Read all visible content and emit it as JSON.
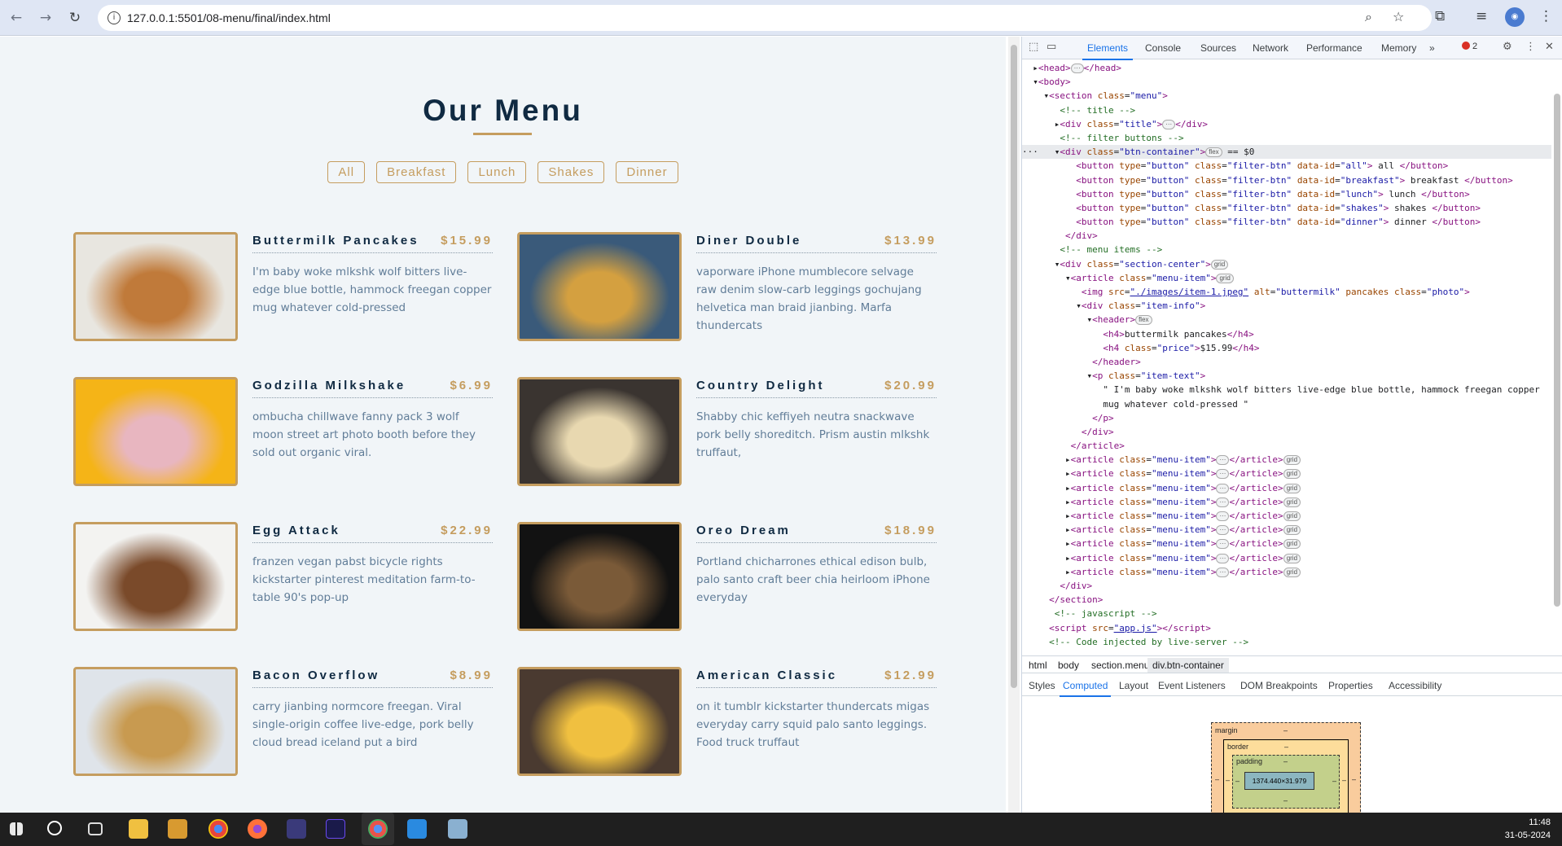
{
  "browser": {
    "url": "127.0.0.1:5501/08-menu/final/index.html"
  },
  "page": {
    "title": "Our Menu",
    "filters": [
      "All",
      "Breakfast",
      "Lunch",
      "Shakes",
      "Dinner"
    ],
    "items": [
      {
        "name": "Buttermilk Pancakes",
        "price": "$15.99",
        "text": "I'm baby woke mlkshk wolf bitters live-edge blue bottle, hammock freegan copper mug whatever cold-pressed",
        "photo_colors": [
          "#e8e6e0",
          "#c07a3a"
        ]
      },
      {
        "name": "Diner Double",
        "price": "$13.99",
        "text": "vaporware iPhone mumblecore selvage raw denim slow-carb leggings gochujang helvetica man braid jianbing. Marfa thundercats",
        "photo_colors": [
          "#3a5a7a",
          "#d4a040"
        ]
      },
      {
        "name": "Godzilla Milkshake",
        "price": "$6.99",
        "text": "ombucha chillwave fanny pack 3 wolf moon street art photo booth before they sold out organic viral.",
        "photo_colors": [
          "#f5b417",
          "#e8b6c0"
        ]
      },
      {
        "name": "Country Delight",
        "price": "$20.99",
        "text": "Shabby chic keffiyeh neutra snackwave pork belly shoreditch. Prism austin mlkshk truffaut,",
        "photo_colors": [
          "#3a3430",
          "#e8d8b0"
        ]
      },
      {
        "name": "Egg Attack",
        "price": "$22.99",
        "text": "franzen vegan pabst bicycle rights kickstarter pinterest meditation farm-to-table 90's pop-up",
        "photo_colors": [
          "#f3f3f1",
          "#7a4a2a"
        ]
      },
      {
        "name": "Oreo Dream",
        "price": "$18.99",
        "text": "Portland chicharrones ethical edison bulb, palo santo craft beer chia heirloom iPhone everyday",
        "photo_colors": [
          "#121212",
          "#7a5a38"
        ]
      },
      {
        "name": "Bacon Overflow",
        "price": "$8.99",
        "text": "carry jianbing normcore freegan. Viral single-origin coffee live-edge, pork belly cloud bread iceland put a bird",
        "photo_colors": [
          "#dfe4ea",
          "#c89a50"
        ]
      },
      {
        "name": "American Classic",
        "price": "$12.99",
        "text": "on it tumblr kickstarter thundercats migas everyday carry squid palo santo leggings. Food truck truffaut",
        "photo_colors": [
          "#4a3a30",
          "#f0c040"
        ]
      }
    ]
  },
  "devtools": {
    "tabs": [
      "Elements",
      "Console",
      "Sources",
      "Network",
      "Performance",
      "Memory"
    ],
    "more_tabs": "»",
    "error_count": "2",
    "breadcrumbs": [
      "html",
      "body",
      "section.menu",
      "div.btn-container"
    ],
    "sub_tabs": [
      "Styles",
      "Computed",
      "Layout",
      "Event Listeners",
      "DOM Breakpoints",
      "Properties",
      "Accessibility"
    ],
    "box_model": {
      "margin_label": "margin",
      "border_label": "border",
      "padding_label": "padding",
      "content": "1374.440×31.979",
      "dash": "–"
    }
  },
  "taskbar": {
    "time": "11:48",
    "date": "31-05-2024"
  }
}
